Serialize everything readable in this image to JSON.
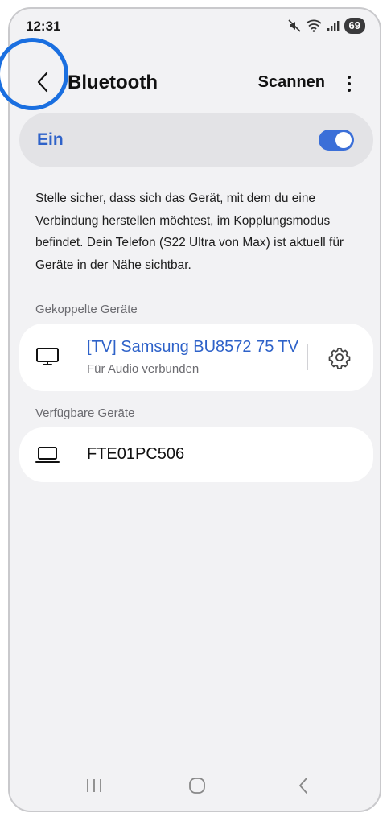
{
  "status_bar": {
    "time": "12:31",
    "battery": "69",
    "icons": [
      "mute-icon",
      "wifi-icon",
      "signal-icon"
    ]
  },
  "app_bar": {
    "title": "Bluetooth",
    "scan_label": "Scannen",
    "back_icon": "chevron-left-icon",
    "more_icon": "more-vertical-icon"
  },
  "toggle": {
    "label": "Ein",
    "state": "on",
    "accent": "#3b6fd8"
  },
  "description": "Stelle sicher, dass sich das Gerät, mit dem du eine Verbindung herstellen möchtest, im Kopplungsmodus befindet. Dein Telefon (S22 Ultra von Max) ist aktuell für Geräte in der Nähe sichtbar.",
  "paired": {
    "header": "Gekoppelte Geräte",
    "devices": [
      {
        "name": "[TV] Samsung BU8572 75 TV",
        "status": "Für Audio verbunden",
        "icon": "tv-icon",
        "name_color": "#2e62c9"
      }
    ]
  },
  "available": {
    "header": "Verfügbare Geräte",
    "devices": [
      {
        "name": "FTE01PC506",
        "icon": "laptop-icon"
      }
    ]
  },
  "nav_bar": {
    "icons": [
      "recent-apps-icon",
      "home-icon",
      "back-icon"
    ]
  }
}
